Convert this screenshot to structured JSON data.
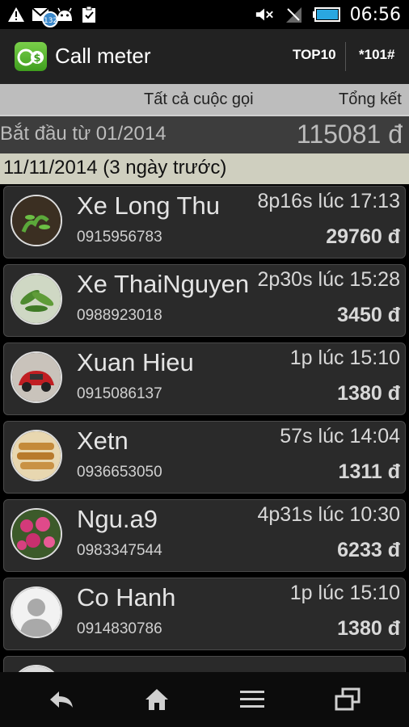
{
  "status_bar": {
    "notification_badge": "132",
    "time": "06:56",
    "icons": [
      "warning-icon",
      "gmail-icon",
      "android-icon",
      "clipboard-check-icon",
      "mute-icon",
      "no-signal-icon",
      "battery-icon"
    ]
  },
  "action_bar": {
    "title": "Call meter",
    "top10_label": "TOP10",
    "ussd_label": "*101#"
  },
  "tabs": {
    "all_calls": "Tất cả cuộc gọi",
    "summary": "Tổng kết"
  },
  "summary": {
    "start_label": "Bắt đầu từ 01/2014",
    "total": "115081 đ"
  },
  "date_header": "11/11/2014 (3 ngày trước)",
  "calls": [
    {
      "name": "Xe Long Thu",
      "phone": "0915956783",
      "duration": "8p16s lúc 17:13",
      "cost": "29760 đ",
      "avatar": "plant-seedling"
    },
    {
      "name": "Xe ThaiNguyen",
      "phone": "0988923018",
      "duration": "2p30s lúc 15:28",
      "cost": "3450 đ",
      "avatar": "green-leaves"
    },
    {
      "name": "Xuan Hieu",
      "phone": "0915086137",
      "duration": "1p lúc 15:10",
      "cost": "1380 đ",
      "avatar": "red-car"
    },
    {
      "name": "Xetn",
      "phone": "0936653050",
      "duration": "57s lúc 14:04",
      "cost": "1311 đ",
      "avatar": "spring-rolls"
    },
    {
      "name": "Ngu.a9",
      "phone": "0983347544",
      "duration": "4p31s lúc 10:30",
      "cost": "6233 đ",
      "avatar": "pink-flowers"
    },
    {
      "name": "Co Hanh",
      "phone": "0914830786",
      "duration": "1p lúc 15:10",
      "cost": "1380 đ",
      "avatar": "default-person"
    }
  ],
  "nav_bar": [
    "back-icon",
    "home-icon",
    "menu-icon",
    "recent-apps-icon"
  ],
  "colors": {
    "action_bar": "#222222",
    "tab_bar": "#bdbdbd",
    "date_header": "#cfcfbf",
    "row_bg": "#2a2a2a",
    "app_icon": "#5bb832"
  }
}
